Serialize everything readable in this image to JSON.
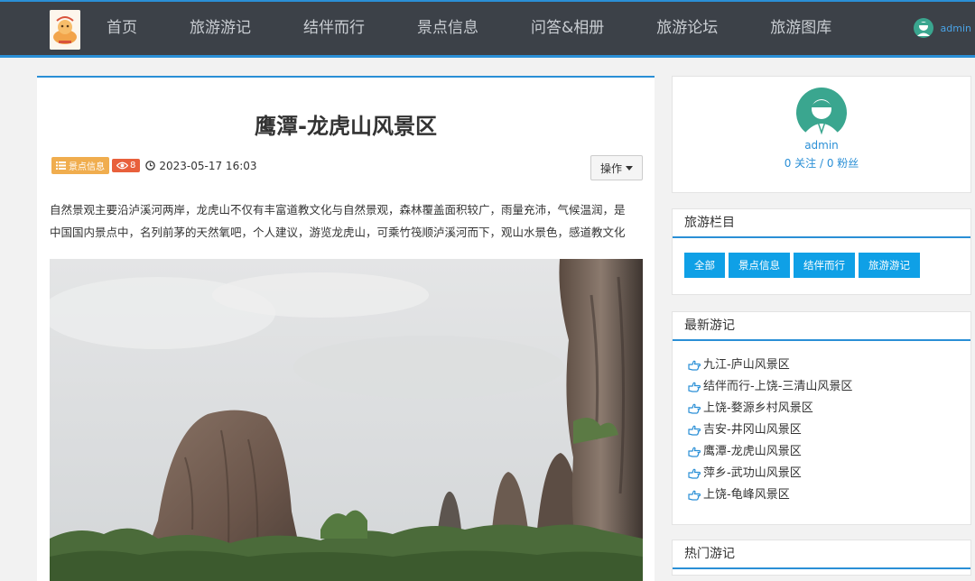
{
  "nav": {
    "items": [
      "首页",
      "旅游游记",
      "结伴而行",
      "景点信息",
      "问答&相册",
      "旅游论坛",
      "旅游图库"
    ],
    "user": "admin"
  },
  "article": {
    "title": "鹰潭-龙虎山风景区",
    "category": "景点信息",
    "views": "8",
    "date": "2023-05-17 16:03",
    "op_label": "操作",
    "text_lines": [
      "自然景观主要沿泸溪河两岸，龙虎山不仅有丰富道教文化与自然景观，森林覆盖面积较广，雨量充沛，气候温润，是",
      "中国国内景点中，名列前茅的天然氧吧，个人建议，游览龙虎山，可乘竹筏顺泸溪河而下，观山水景色，感道教文化"
    ]
  },
  "profile": {
    "name": "admin",
    "follow": "0 关注 / 0 粉丝"
  },
  "categories": {
    "title": "旅游栏目",
    "buttons": [
      "全部",
      "景点信息",
      "结伴而行",
      "旅游游记"
    ]
  },
  "newest": {
    "title": "最新游记",
    "items": [
      "九江-庐山风景区",
      "结伴而行-上饶-三清山风景区",
      "上饶-婺源乡村风景区",
      "吉安-井冈山风景区",
      "鹰潭-龙虎山风景区",
      "萍乡-武功山风景区",
      "上饶-龟峰风景区"
    ]
  },
  "hot": {
    "title": "热门游记"
  },
  "colors": {
    "nav_bg": "#3c4148",
    "accent": "#2a8fd6",
    "button_blue": "#0fa0e6",
    "tag_orange": "#f0ad4e",
    "tag_red": "#e8603c"
  }
}
